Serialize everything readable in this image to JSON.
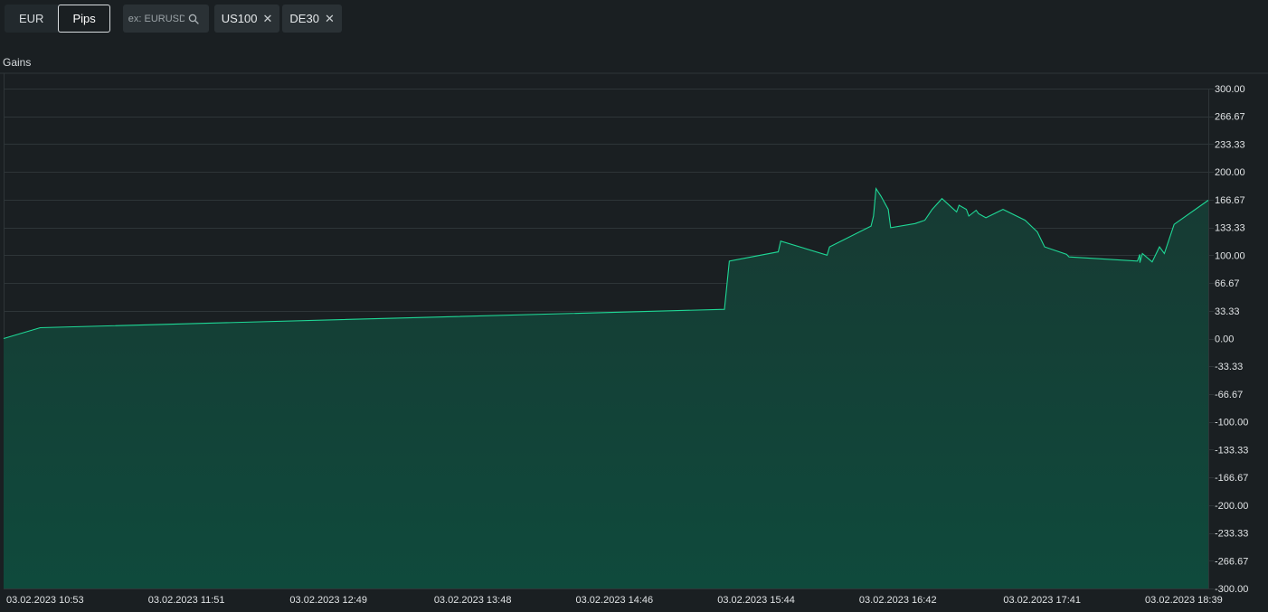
{
  "toolbar": {
    "units": [
      {
        "label": "EUR",
        "active": false
      },
      {
        "label": "Pips",
        "active": true
      }
    ],
    "search": {
      "placeholder": "ex: EURUSD",
      "value": ""
    },
    "tags": [
      {
        "label": "US100"
      },
      {
        "label": "DE30"
      }
    ]
  },
  "chart_title": "Gains",
  "colors": {
    "line": "#1fd896",
    "fill_top": "#173a33",
    "fill_bottom": "#0f4a3c",
    "grid": "#2e3538",
    "background": "#1a1f22"
  },
  "chart_data": {
    "type": "area",
    "title": "Gains",
    "xlabel": "",
    "ylabel": "",
    "ylim": [
      -300,
      300
    ],
    "yticks": [
      300,
      266.67,
      233.33,
      200,
      166.67,
      133.33,
      100,
      66.67,
      33.33,
      0,
      -33.33,
      -66.67,
      -100,
      -133.33,
      -166.67,
      -200,
      -233.33,
      -266.67,
      -300
    ],
    "ytick_labels": [
      "300.00",
      "266.67",
      "233.33",
      "200.00",
      "166.67",
      "133.33",
      "100.00",
      "66.67",
      "33.33",
      "0.00",
      "-33.33",
      "-66.67",
      "-100.00",
      "-133.33",
      "-166.67",
      "-200.00",
      "-233.33",
      "-266.67",
      "-300.00"
    ],
    "xlim": [
      "10:53",
      "19:06"
    ],
    "xticks": [
      "10:53",
      "11:51",
      "12:49",
      "13:48",
      "14:46",
      "15:44",
      "16:42",
      "17:41",
      "18:39"
    ],
    "xtick_labels": [
      "03.02.2023 10:53",
      "03.02.2023 11:51",
      "03.02.2023 12:49",
      "03.02.2023 13:48",
      "03.02.2023 14:46",
      "03.02.2023 15:44",
      "03.02.2023 16:42",
      "03.02.2023 17:41",
      "03.02.2023 18:39"
    ],
    "grid": true,
    "series": [
      {
        "x": [
          "10:53",
          "11:08",
          "15:48",
          "15:50",
          "16:10",
          "16:11",
          "16:30",
          "16:31",
          "16:48",
          "16:49",
          "16:50",
          "16:52",
          "16:55",
          "16:56",
          "17:06",
          "17:10",
          "17:13",
          "17:17",
          "17:23",
          "17:24",
          "17:27",
          "17:28",
          "17:31",
          "17:32",
          "17:35",
          "17:42",
          "17:51",
          "17:56",
          "17:59",
          "18:08",
          "18:09",
          "18:37",
          "18:38",
          "18:38",
          "18:39",
          "18:43",
          "18:46",
          "18:48",
          "18:52",
          "19:06"
        ],
        "y": [
          0,
          13,
          35,
          93,
          104,
          117,
          100,
          110,
          135,
          147,
          180,
          171,
          155,
          133,
          138,
          142,
          155,
          168,
          152,
          160,
          155,
          147,
          154,
          150,
          145,
          155,
          142,
          128,
          110,
          101,
          98,
          93,
          101,
          91,
          102,
          92,
          110,
          102,
          137,
          166
        ]
      }
    ]
  }
}
